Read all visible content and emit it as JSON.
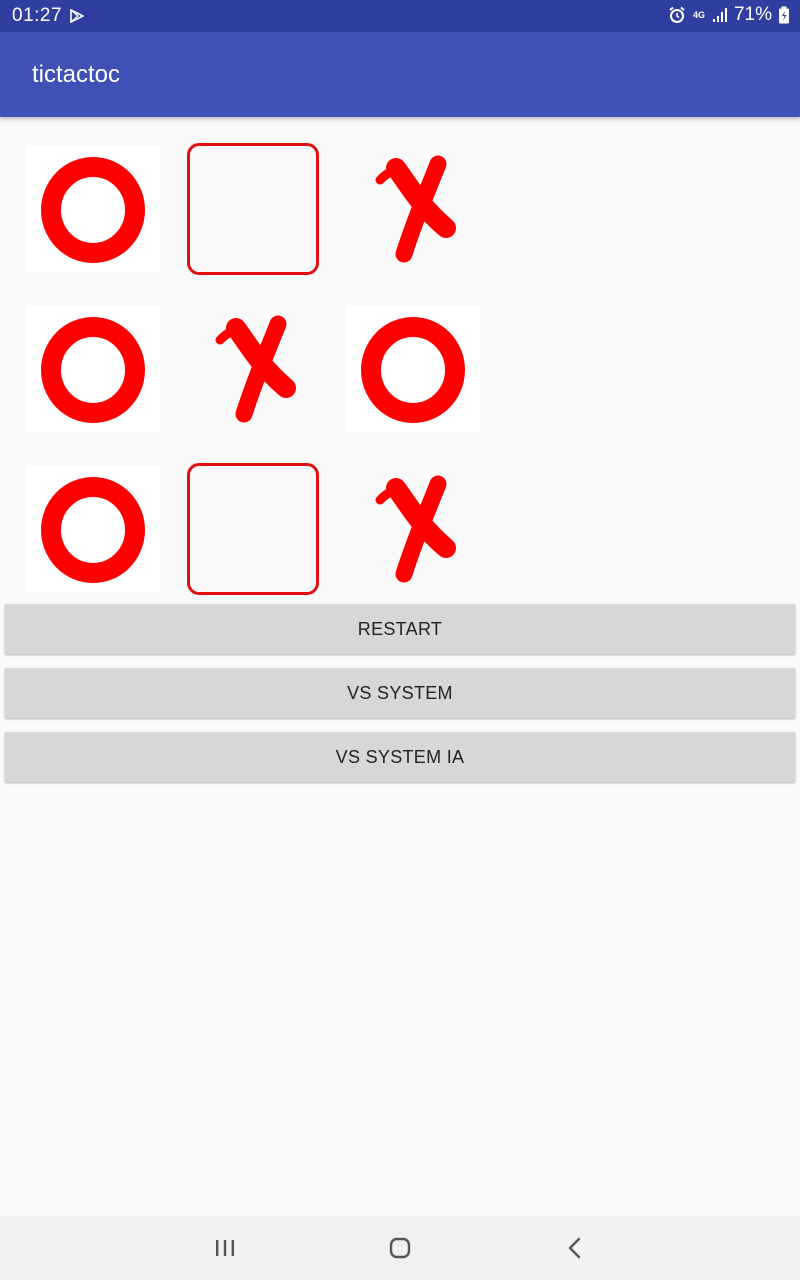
{
  "status_bar": {
    "time": "01:27",
    "network_type": "4G",
    "battery": "71%",
    "icons": [
      "play-store-icon",
      "alarm-icon",
      "signal-icon",
      "battery-icon"
    ]
  },
  "app_bar": {
    "title": "tictactoc"
  },
  "board": {
    "cells": [
      [
        "O",
        "",
        "X"
      ],
      [
        "O",
        "X",
        "O"
      ],
      [
        "O",
        "",
        "X"
      ]
    ]
  },
  "buttons": {
    "restart": "RESTART",
    "vs_system": "VS SYSTEM",
    "vs_system_ia": "VS SYSTEM IA"
  },
  "nav_bar": {
    "icons": [
      "recents-icon",
      "home-icon",
      "back-icon"
    ]
  },
  "colors": {
    "status_bar": "#303f9f",
    "app_bar": "#3f51b5",
    "mark": "#ff0000",
    "button": "#d6d7d7"
  }
}
